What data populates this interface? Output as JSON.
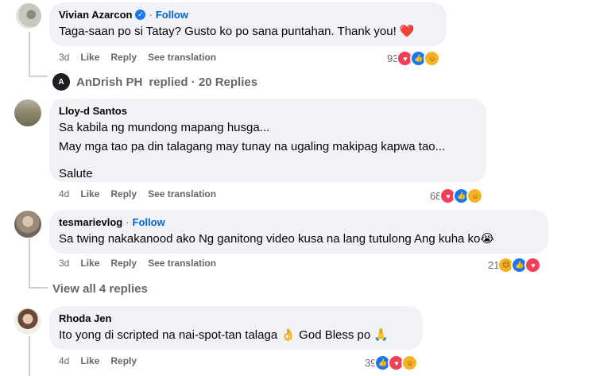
{
  "comments": [
    {
      "author": "Vivian Azarcon",
      "follow": "Follow",
      "lines": [
        "Taga-saan po si Tatay? Gusto ko po sana puntahan. Thank you! ❤️"
      ],
      "time": "3d",
      "like": "Like",
      "reply": "Reply",
      "translate": "See translation",
      "reaction_count": "93",
      "reactions": [
        "love",
        "like",
        "care"
      ]
    },
    {
      "author": "Lloy-d Santos",
      "lines": [
        "Sa kabila ng mundong mapang husga...",
        "May mga tao pa din talagang may tunay na ugaling makipag kapwa tao...",
        "",
        "Salute"
      ],
      "time": "4d",
      "like": "Like",
      "reply": "Reply",
      "translate": "See translation",
      "reaction_count": "68",
      "reactions": [
        "love",
        "like",
        "care"
      ]
    },
    {
      "author": "tesmarievlog",
      "follow": "Follow",
      "lines": [
        "Sa twing nakakanood ako Ng ganitong video kusa na lang tutulong Ang kuha ko😭"
      ],
      "time": "3d",
      "like": "Like",
      "reply": "Reply",
      "translate": "See translation",
      "reaction_count": "21",
      "reactions": [
        "sad",
        "like",
        "love"
      ]
    },
    {
      "author": "Rhoda Jen",
      "lines": [
        "Ito yong di scripted na nai-spot-tan talaga 👌 God Bless po 🙏"
      ],
      "time": "4d",
      "like": "Like",
      "reply": "Reply",
      "reaction_count": "39",
      "reactions": [
        "like",
        "love",
        "care"
      ]
    }
  ],
  "replied": {
    "page": "AnDrish PH",
    "text": "replied · 20 Replies"
  },
  "view_all": "View all 4 replies",
  "colors": {
    "bubble": "#f0f2f5",
    "follow": "#0064d1",
    "meta": "#65676b",
    "love": "#f33e58",
    "like": "#1877f2",
    "care": "#f7b125"
  }
}
